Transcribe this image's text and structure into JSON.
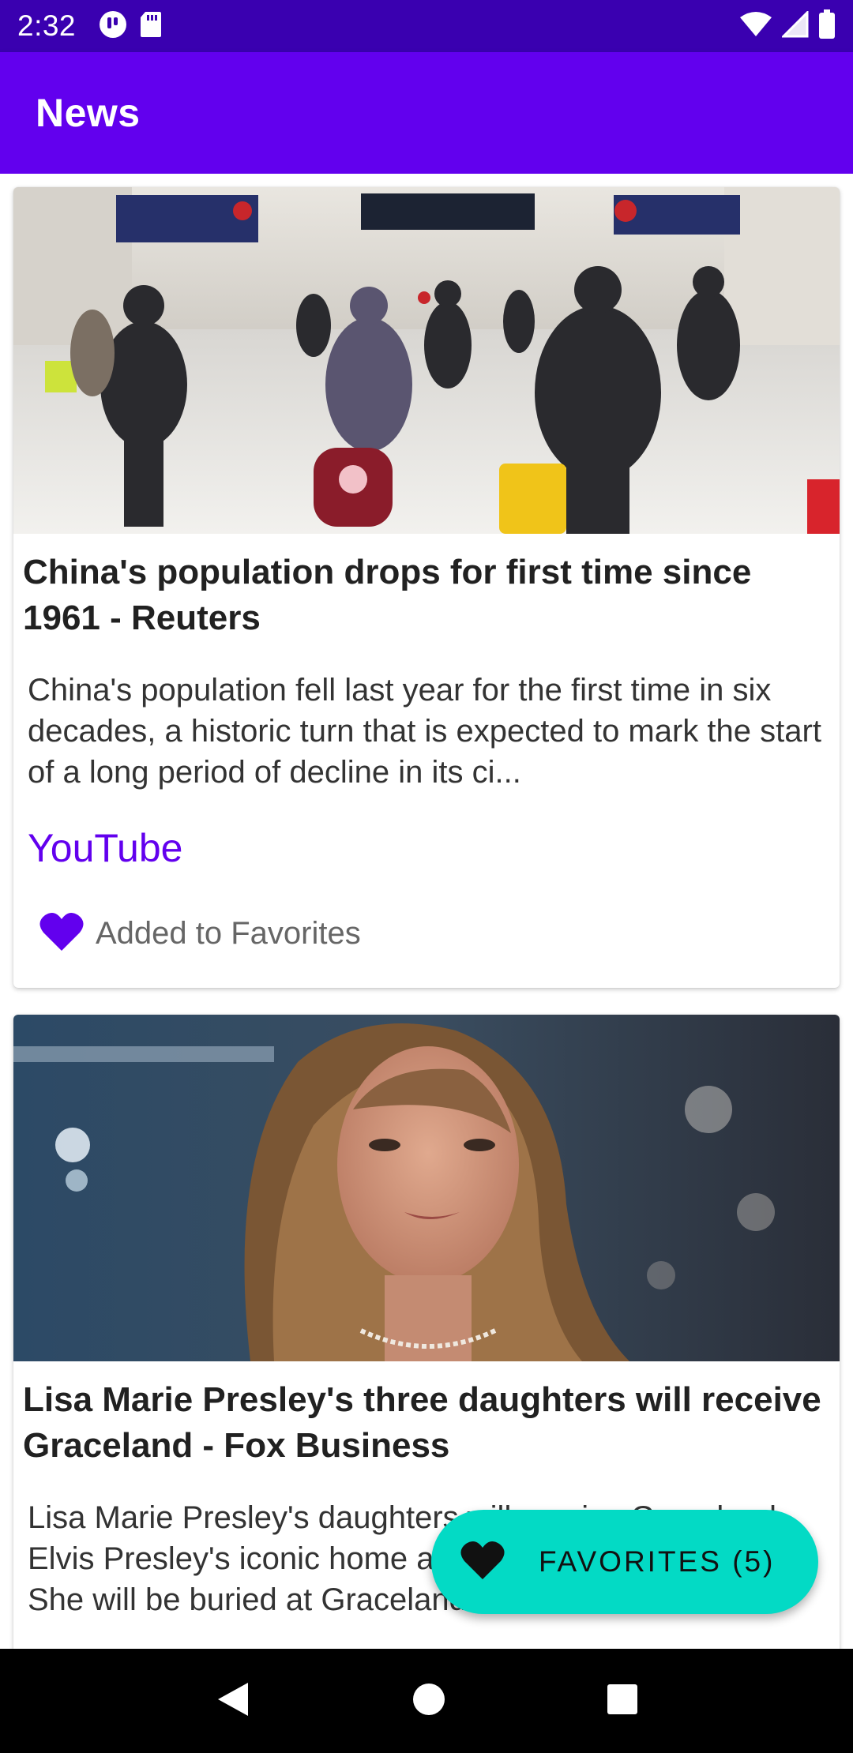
{
  "status_bar": {
    "time": "2:32",
    "icons_left": [
      "cast-icon",
      "sd-card-icon"
    ],
    "icons_right": [
      "wifi-icon",
      "signal-icon",
      "battery-icon"
    ]
  },
  "app_bar": {
    "title": "News"
  },
  "articles": [
    {
      "image": "photo of crowded train station with travelers in masks",
      "title": "China's population drops for first time since 1961 - Reuters",
      "description": "China's population fell last year for the first time in six decades, a historic turn that is expected to mark the start of a long period of decline in its ci...",
      "source": "YouTube",
      "favorite_label": "Added to Favorites",
      "favorite_icon": "heart-icon"
    },
    {
      "image": "portrait photo of a woman with long hair",
      "title": "Lisa Marie Presley's three daughters will receive Graceland - Fox Business",
      "description": "Lisa Marie Presley's daughters will receive Graceland, Elvis Presley's iconic home after she died on Thursday. She will be buried at Graceland."
    }
  ],
  "fab": {
    "label": "FAVORITES (5)",
    "icon": "heart-icon"
  },
  "nav_bar": {
    "icons": [
      "back-icon",
      "home-icon",
      "recents-icon"
    ]
  },
  "colors": {
    "status_bar": "#3a00b0",
    "app_bar": "#6200ee",
    "accent": "#6200ee",
    "fab": "#03dac5",
    "nav_bar": "#000000"
  }
}
